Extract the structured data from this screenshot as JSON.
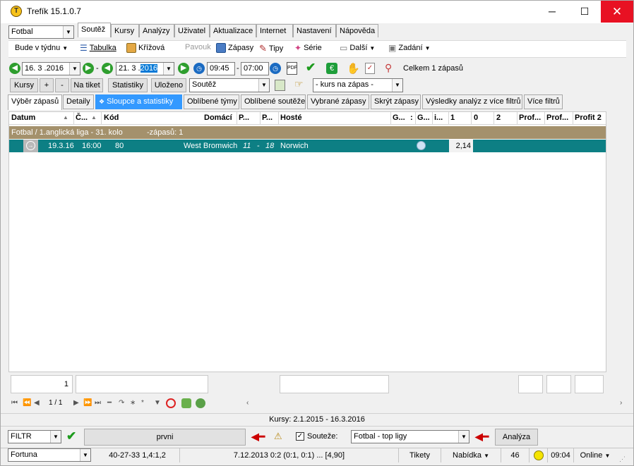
{
  "window": {
    "title": "Trefík 15.1.0.7",
    "minimize": "─",
    "maximize": "☐",
    "close": "✕"
  },
  "sport_select": "Fotbal",
  "period_select": "Bude v týdnu",
  "menu_tabs": [
    "Soutěž",
    "Kursy",
    "Analýzy",
    "Uživatel",
    "Aktualizace",
    "Internet",
    "Nastavení",
    "Nápověda"
  ],
  "toolbar": {
    "tabulka": "Tabulka",
    "krizova": "Křížová",
    "pavouk": "Pavouk",
    "zapasy": "Zápasy",
    "tipy": "Tipy",
    "serie": "Série",
    "dalsi": "Další",
    "zadani": "Zadání"
  },
  "date_bar": {
    "date_from": "16. 3 .2016",
    "date_to_prefix": "21. 3 .",
    "date_to_year": "2016",
    "time_from": "09:45",
    "time_to": "07:00",
    "dash": "-",
    "summary": "Celkem 1 zápasů"
  },
  "action_bar": {
    "kursy": "Kursy",
    "plus": "+",
    "minus": "-",
    "na_tiket": "Na tiket",
    "statistiky": "Statistiky",
    "ulozeno": "Uloženo",
    "soutez_combo": "Soutěž",
    "kurs_combo": "- kurs na zápas -"
  },
  "filter_tabs": [
    "Výběr zápasů",
    "Detaily",
    "Sloupce a statistiky",
    "Oblíbené týmy",
    "Oblíbené soutěže",
    "Vybrané zápasy",
    "Skrýt zápasy",
    "Výsledky analýz z více filtrů",
    "Více filtrů"
  ],
  "grid": {
    "headers": [
      "Datum",
      "Č...",
      "Kód",
      "Domácí",
      "P...",
      "P...",
      "Hosté",
      "G...",
      ":",
      "G...",
      "i...",
      "1",
      "0",
      "2",
      "Prof...",
      "Prof...",
      "Profit 2"
    ],
    "group_row": {
      "league": "Fotbal / 1.anglická liga - 31. kolo",
      "count": "-zápasů: 1"
    },
    "rows": [
      {
        "datum": "19.3.16",
        "cas": "16:00",
        "kod": "80",
        "domaci": "West Bromwich",
        "pos_home": "11",
        "sep": "-",
        "pos_away": "18",
        "hoste": "Norwich",
        "kurs1": "2,14"
      }
    ],
    "footer_count": "1"
  },
  "nav_bar": {
    "page": "1 / 1"
  },
  "kursy_range": "Kursy: 2.1.2015 - 16.3.2016",
  "bottom_bar": {
    "filtr": "FILTR",
    "filter_name": "prvni",
    "soutez_label": "Souteže:",
    "soutez_value": "Fotbal - top ligy",
    "analyza": "Analýza"
  },
  "status_bar": {
    "bookmaker": "Fortuna",
    "stats": "40-27-33  1,4:1,2",
    "last_match": "7.12.2013 0:2 (0:1, 0:1) ... [4,90]",
    "tikety": "Tikety",
    "nabidka": "Nabídka",
    "count": "46",
    "time": "09:04",
    "online": "Online"
  }
}
